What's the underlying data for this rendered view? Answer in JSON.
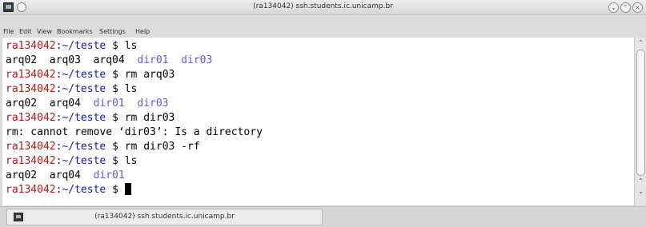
{
  "window": {
    "title": "(ra134042) ssh.students.ic.unicamp.br"
  },
  "menubar": {
    "items": [
      "File",
      "Edit",
      "View",
      "Bookmarks",
      "Settings",
      "Help"
    ]
  },
  "terminal": {
    "prompt_user": "ra134042",
    "prompt_path": ":~/teste",
    "prompt_symbol": " $ ",
    "lines": [
      {
        "type": "cmd",
        "cmd": "ls"
      },
      {
        "type": "out",
        "plain": "arq02  arq03  arq04  ",
        "dirs": "dir01  dir03"
      },
      {
        "type": "cmd",
        "cmd": "rm arq03"
      },
      {
        "type": "cmd",
        "cmd": "ls"
      },
      {
        "type": "out",
        "plain": "arq02  arq04  ",
        "dirs": "dir01  dir03"
      },
      {
        "type": "cmd",
        "cmd": "rm dir03"
      },
      {
        "type": "err",
        "text": "rm: cannot remove ‘dir03’: Is a directory"
      },
      {
        "type": "cmd",
        "cmd": "rm dir03 -rf"
      },
      {
        "type": "cmd",
        "cmd": "ls"
      },
      {
        "type": "out",
        "plain": "arq02  arq04  ",
        "dirs": "dir01"
      },
      {
        "type": "cmd",
        "cmd": ""
      }
    ]
  },
  "tabbar": {
    "tab_label": "(ra134042) ssh.students.ic.unicamp.br"
  },
  "colors": {
    "prompt_user": "#b21818",
    "prompt_path": "#1818b2",
    "directory": "#5c5ce0"
  },
  "icons": [
    "terminal-app-icon",
    "pin-icon",
    "minimize-icon",
    "maximize-icon",
    "close-icon",
    "scroll-up-icon",
    "scroll-down-icon",
    "tab-terminal-icon"
  ]
}
